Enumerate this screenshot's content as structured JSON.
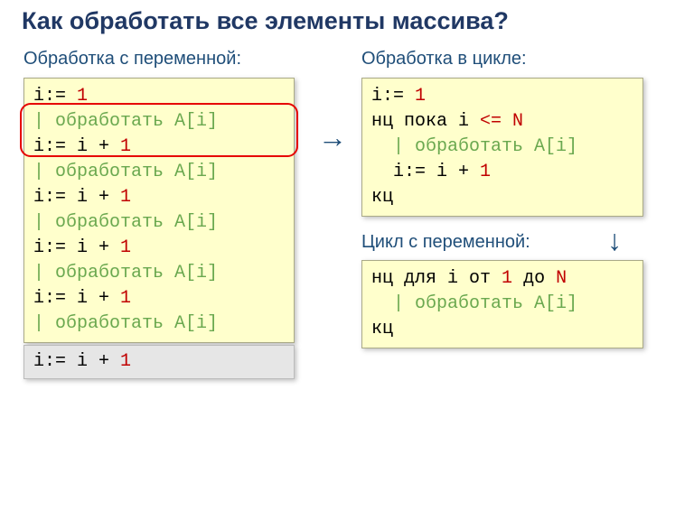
{
  "title": "Как обработать все элементы массива?",
  "subheadings": {
    "left": "Обработка с переменной:",
    "right": "Обработка в цикле:",
    "loopvar": "Цикл с переменной:"
  },
  "left_code_html": "<span class=\"kw\">i:=</span> <span class=\"num\">1</span>\n<span class=\"comment\">| обработать A[i]</span>\n<span class=\"kw\">i:= i +</span> <span class=\"num\">1</span>\n<span class=\"comment\">| обработать A[i]</span>\n<span class=\"kw\">i:= i +</span> <span class=\"num\">1</span>\n<span class=\"comment\">| обработать A[i]</span>\n<span class=\"kw\">i:= i +</span> <span class=\"num\">1</span>\n<span class=\"comment\">| обработать A[i]</span>\n<span class=\"kw\">i:= i +</span> <span class=\"num\">1</span>\n<span class=\"comment\">| обработать A[i]</span>",
  "grey_code_html": "i:= i + <span class=\"num\">1</span>",
  "right1_code_html": "<span class=\"kw\">i:=</span> <span class=\"num\">1</span>\n<span class=\"kw\">нц пока i</span> <span class=\"num\">&lt;= N</span>\n  <span class=\"comment\">| обработать A[i]</span>\n  <span class=\"kw\">i:= i +</span> <span class=\"num\">1</span>\n<span class=\"kw\">кц</span>",
  "right2_code_html": "<span class=\"kw\">нц для i от</span> <span class=\"num\">1</span> <span class=\"kw\">до</span> <span class=\"num\">N</span>\n  <span class=\"comment\">| обработать A[i]</span>\n<span class=\"kw\">кц</span>",
  "arrows": {
    "horizontal": "→",
    "vertical": "↓"
  }
}
